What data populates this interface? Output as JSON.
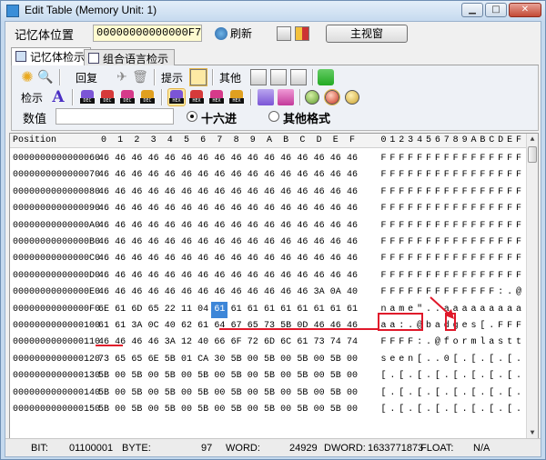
{
  "window": {
    "title": "Edit Table (Memory Unit: 1)",
    "minimize": "▁",
    "maximize": "□",
    "close": "✕"
  },
  "addressbar": {
    "label": "记忆体位置",
    "address": "00000000000000F7",
    "refresh_label": "刷新",
    "mainview_label": "主视窗"
  },
  "tabs": [
    {
      "label": "记忆体检示"
    },
    {
      "label": "组合语言检示"
    }
  ],
  "toolbar": {
    "restore_label": "回复",
    "hint_label": "提示",
    "other_label": "其他",
    "view_label": "检示",
    "chip_texts": {
      "dec": "DEC",
      "hex": "HEX"
    }
  },
  "numbar": {
    "label": "数值",
    "value": "",
    "radio_hex": "十六进",
    "radio_other": "其他格式"
  },
  "grid": {
    "position_header": "Position",
    "hex_headers": [
      "0",
      "1",
      "2",
      "3",
      "4",
      "5",
      "6",
      "7",
      "8",
      "9",
      "A",
      "B",
      "C",
      "D",
      "E",
      "F"
    ],
    "ascii_headers": [
      "0",
      "1",
      "2",
      "3",
      "4",
      "5",
      "6",
      "7",
      "8",
      "9",
      "A",
      "B",
      "C",
      "D",
      "E",
      "F"
    ],
    "rows": [
      {
        "pos": "0000000000000060",
        "hex": [
          "46",
          "46",
          "46",
          "46",
          "46",
          "46",
          "46",
          "46",
          "46",
          "46",
          "46",
          "46",
          "46",
          "46",
          "46",
          "46"
        ],
        "ascii": [
          "F",
          "F",
          "F",
          "F",
          "F",
          "F",
          "F",
          "F",
          "F",
          "F",
          "F",
          "F",
          "F",
          "F",
          "F",
          "F"
        ]
      },
      {
        "pos": "0000000000000070",
        "hex": [
          "46",
          "46",
          "46",
          "46",
          "46",
          "46",
          "46",
          "46",
          "46",
          "46",
          "46",
          "46",
          "46",
          "46",
          "46",
          "46"
        ],
        "ascii": [
          "F",
          "F",
          "F",
          "F",
          "F",
          "F",
          "F",
          "F",
          "F",
          "F",
          "F",
          "F",
          "F",
          "F",
          "F",
          "F"
        ]
      },
      {
        "pos": "0000000000000080",
        "hex": [
          "46",
          "46",
          "46",
          "46",
          "46",
          "46",
          "46",
          "46",
          "46",
          "46",
          "46",
          "46",
          "46",
          "46",
          "46",
          "46"
        ],
        "ascii": [
          "F",
          "F",
          "F",
          "F",
          "F",
          "F",
          "F",
          "F",
          "F",
          "F",
          "F",
          "F",
          "F",
          "F",
          "F",
          "F"
        ]
      },
      {
        "pos": "0000000000000090",
        "hex": [
          "46",
          "46",
          "46",
          "46",
          "46",
          "46",
          "46",
          "46",
          "46",
          "46",
          "46",
          "46",
          "46",
          "46",
          "46",
          "46"
        ],
        "ascii": [
          "F",
          "F",
          "F",
          "F",
          "F",
          "F",
          "F",
          "F",
          "F",
          "F",
          "F",
          "F",
          "F",
          "F",
          "F",
          "F"
        ]
      },
      {
        "pos": "00000000000000A0",
        "hex": [
          "46",
          "46",
          "46",
          "46",
          "46",
          "46",
          "46",
          "46",
          "46",
          "46",
          "46",
          "46",
          "46",
          "46",
          "46",
          "46"
        ],
        "ascii": [
          "F",
          "F",
          "F",
          "F",
          "F",
          "F",
          "F",
          "F",
          "F",
          "F",
          "F",
          "F",
          "F",
          "F",
          "F",
          "F"
        ]
      },
      {
        "pos": "00000000000000B0",
        "hex": [
          "46",
          "46",
          "46",
          "46",
          "46",
          "46",
          "46",
          "46",
          "46",
          "46",
          "46",
          "46",
          "46",
          "46",
          "46",
          "46"
        ],
        "ascii": [
          "F",
          "F",
          "F",
          "F",
          "F",
          "F",
          "F",
          "F",
          "F",
          "F",
          "F",
          "F",
          "F",
          "F",
          "F",
          "F"
        ]
      },
      {
        "pos": "00000000000000C0",
        "hex": [
          "46",
          "46",
          "46",
          "46",
          "46",
          "46",
          "46",
          "46",
          "46",
          "46",
          "46",
          "46",
          "46",
          "46",
          "46",
          "46"
        ],
        "ascii": [
          "F",
          "F",
          "F",
          "F",
          "F",
          "F",
          "F",
          "F",
          "F",
          "F",
          "F",
          "F",
          "F",
          "F",
          "F",
          "F"
        ]
      },
      {
        "pos": "00000000000000D0",
        "hex": [
          "46",
          "46",
          "46",
          "46",
          "46",
          "46",
          "46",
          "46",
          "46",
          "46",
          "46",
          "46",
          "46",
          "46",
          "46",
          "46"
        ],
        "ascii": [
          "F",
          "F",
          "F",
          "F",
          "F",
          "F",
          "F",
          "F",
          "F",
          "F",
          "F",
          "F",
          "F",
          "F",
          "F",
          "F"
        ]
      },
      {
        "pos": "00000000000000E0",
        "hex": [
          "46",
          "46",
          "46",
          "46",
          "46",
          "46",
          "46",
          "46",
          "46",
          "46",
          "46",
          "46",
          "46",
          "3A",
          "0A",
          "40"
        ],
        "ascii": [
          "F",
          "F",
          "F",
          "F",
          "F",
          "F",
          "F",
          "F",
          "F",
          "F",
          "F",
          "F",
          "F",
          ":",
          ".",
          "@"
        ]
      },
      {
        "pos": "00000000000000F0",
        "hex": [
          "6E",
          "61",
          "6D",
          "65",
          "22",
          "11",
          "04",
          "61",
          "61",
          "61",
          "61",
          "61",
          "61",
          "61",
          "61",
          "61"
        ],
        "ascii": [
          "n",
          "a",
          "m",
          "e",
          "\"",
          ".",
          ".",
          "a",
          "a",
          "a",
          "a",
          "a",
          "a",
          "a",
          "a",
          "a"
        ]
      },
      {
        "pos": "0000000000000100",
        "hex": [
          "61",
          "61",
          "3A",
          "0C",
          "40",
          "62",
          "61",
          "64",
          "67",
          "65",
          "73",
          "5B",
          "0D",
          "46",
          "46",
          "46"
        ],
        "ascii": [
          "a",
          "a",
          ":",
          ".",
          "@",
          "b",
          "a",
          "d",
          "g",
          "e",
          "s",
          "[",
          ".",
          "F",
          "F",
          "F"
        ]
      },
      {
        "pos": "0000000000000110",
        "hex": [
          "46",
          "46",
          "46",
          "46",
          "3A",
          "12",
          "40",
          "66",
          "6F",
          "72",
          "6D",
          "6C",
          "61",
          "73",
          "74",
          "74"
        ],
        "ascii": [
          "F",
          "F",
          "F",
          "F",
          ":",
          ".",
          "@",
          "f",
          "o",
          "r",
          "m",
          "l",
          "a",
          "s",
          "t",
          "t"
        ]
      },
      {
        "pos": "0000000000000120",
        "hex": [
          "73",
          "65",
          "65",
          "6E",
          "5B",
          "01",
          "CA",
          "30",
          "5B",
          "00",
          "5B",
          "00",
          "5B",
          "00",
          "5B",
          "00"
        ],
        "ascii": [
          "s",
          "e",
          "e",
          "n",
          "[",
          ".",
          ".",
          "0",
          "[",
          ".",
          "[",
          ".",
          "[",
          ".",
          "[",
          "."
        ]
      },
      {
        "pos": "0000000000000130",
        "hex": [
          "5B",
          "00",
          "5B",
          "00",
          "5B",
          "00",
          "5B",
          "00",
          "5B",
          "00",
          "5B",
          "00",
          "5B",
          "00",
          "5B",
          "00"
        ],
        "ascii": [
          "[",
          ".",
          "[",
          ".",
          "[",
          ".",
          "[",
          ".",
          "[",
          ".",
          "[",
          ".",
          "[",
          ".",
          "[",
          "."
        ]
      },
      {
        "pos": "0000000000000140",
        "hex": [
          "5B",
          "00",
          "5B",
          "00",
          "5B",
          "00",
          "5B",
          "00",
          "5B",
          "00",
          "5B",
          "00",
          "5B",
          "00",
          "5B",
          "00"
        ],
        "ascii": [
          "[",
          ".",
          "[",
          ".",
          "[",
          ".",
          "[",
          ".",
          "[",
          ".",
          "[",
          ".",
          "[",
          ".",
          "[",
          "."
        ]
      },
      {
        "pos": "0000000000000150",
        "hex": [
          "5B",
          "00",
          "5B",
          "00",
          "5B",
          "00",
          "5B",
          "00",
          "5B",
          "00",
          "5B",
          "00",
          "5B",
          "00",
          "5B",
          "00"
        ],
        "ascii": [
          "[",
          ".",
          "[",
          ".",
          "[",
          ".",
          "[",
          ".",
          "[",
          ".",
          "[",
          ".",
          "[",
          ".",
          "[",
          "."
        ]
      }
    ]
  },
  "statusbar": {
    "bit_label": "BIT:",
    "bit_value": "01100001",
    "byte_label": "BYTE:",
    "byte_value": "97",
    "word_label": "WORD:",
    "word_value": "24929",
    "dword_label": "DWORD:",
    "dword_value": "1633771873",
    "float_label": "FLOAT:",
    "float_value": "N/A"
  },
  "colors": {
    "highlight": "#3d86d8",
    "annotation": "#e0182a",
    "address_bg": "#fffbd0"
  }
}
